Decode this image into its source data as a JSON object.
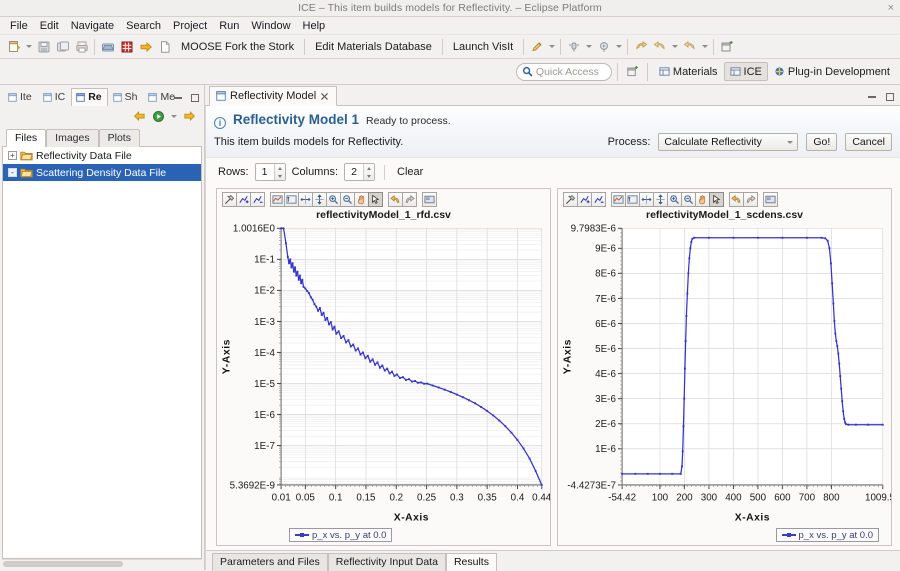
{
  "window": {
    "title": "ICE – This item builds models for Reflectivity. – Eclipse Platform",
    "close_label": "×"
  },
  "menu": {
    "items": [
      "File",
      "Edit",
      "Navigate",
      "Search",
      "Project",
      "Run",
      "Window",
      "Help"
    ]
  },
  "toolbar": {
    "text_buttons": [
      "MOOSE Fork the Stork",
      "Edit Materials Database",
      "Launch VisIt"
    ],
    "icons": [
      "new-wizard-icon",
      "save-icon",
      "save-all-icon",
      "print-icon",
      "open-item-icon",
      "grid-icon",
      "forward-arrow-icon",
      "new-file-icon",
      "run-visit-icon",
      "debug-icon",
      "run-icon",
      "back-nav-icon",
      "forward-nav-icon",
      "next-annotation-icon",
      "open-perspective-icon"
    ]
  },
  "quick_access": {
    "placeholder": "Quick Access",
    "search_icon": "search-icon"
  },
  "perspectives": {
    "open_icon": "open-perspective-icon",
    "items": [
      {
        "label": "Materials",
        "active": false
      },
      {
        "label": "ICE",
        "active": true
      },
      {
        "label": "Plug-in Development",
        "active": false
      }
    ]
  },
  "sidebar": {
    "tabs": [
      {
        "label": "Ite",
        "active": false
      },
      {
        "label": "IC",
        "active": false
      },
      {
        "label": "Re",
        "active": true
      },
      {
        "label": "Sh",
        "active": false
      },
      {
        "label": "Me",
        "active": false
      }
    ],
    "nav": [
      "back-arrow-icon",
      "play-icon",
      "chevron-down-icon",
      "forward-arrow-icon"
    ],
    "minimize_icon": "minimize-icon",
    "maximize_icon": "maximize-icon",
    "subtabs": [
      {
        "label": "Files",
        "active": true
      },
      {
        "label": "Images",
        "active": false
      },
      {
        "label": "Plots",
        "active": false
      }
    ],
    "tree": [
      {
        "label": "Reflectivity Data File",
        "expander": "+",
        "selected": false
      },
      {
        "label": "Scattering Density Data File",
        "expander": "-",
        "selected": true
      }
    ]
  },
  "editor": {
    "tab": {
      "label": "Reflectivity Model",
      "close_icon": "close-icon",
      "editor_icon": "editor-icon"
    },
    "minimize_icon": "minimize-icon",
    "maximize_icon": "maximize-icon",
    "form": {
      "info_icon": "info-icon",
      "title": "Reflectivity Model 1",
      "status": "Ready to process.",
      "description": "This item builds models for Reflectivity.",
      "process_label": "Process:",
      "process_value": "Calculate Reflectivity",
      "process_options": [
        "Calculate Reflectivity"
      ],
      "go_label": "Go!",
      "cancel_label": "Cancel"
    },
    "grid_controls": {
      "rows_label": "Rows:",
      "rows_value": "1",
      "columns_label": "Columns:",
      "columns_value": "2",
      "clear_label": "Clear"
    },
    "bottom_tabs": [
      {
        "label": "Parameters and Files",
        "active": false
      },
      {
        "label": "Reflectivity Input Data",
        "active": false
      },
      {
        "label": "Results",
        "active": true
      }
    ]
  },
  "plot_toolbar": {
    "buttons": [
      "clear-plot-icon",
      "add-series-icon",
      "remove-series-icon",
      "auto-scale-icon",
      "auto-scale-y-icon",
      "auto-scale-x-icon",
      "snap-to-grid-icon",
      "zoom-in-icon",
      "zoom-out-icon",
      "pan-icon",
      "select-icon",
      "undo-icon",
      "redo-icon",
      "save-image-icon"
    ],
    "active_button": "select-icon"
  },
  "chart_data": [
    {
      "type": "line",
      "title": "reflectivityModel_1_rfd.csv",
      "xlabel": "X-Axis",
      "ylabel": "Y-Axis",
      "yscale": "log",
      "xlim": [
        0.01,
        0.44
      ],
      "ylim": [
        5.3692e-09,
        1.0016
      ],
      "ytick_labels": [
        "1.0016E0",
        "1E-1",
        "1E-2",
        "1E-3",
        "1E-4",
        "1E-5",
        "1E-6",
        "1E-7",
        "5.3692E-9"
      ],
      "ytick_values": [
        1.0016,
        0.1,
        0.01,
        0.001,
        0.0001,
        1e-05,
        1e-06,
        1e-07,
        5.3692e-09
      ],
      "xtick_labels": [
        "0.01",
        "0.05",
        "0.1",
        "0.15",
        "0.2",
        "0.25",
        "0.3",
        "0.35",
        "0.4",
        "0.44"
      ],
      "xtick_values": [
        0.01,
        0.05,
        0.1,
        0.15,
        0.2,
        0.25,
        0.3,
        0.35,
        0.4,
        0.44
      ],
      "legend": "p_x vs. p_y at 0.0",
      "legend_position": "bottom-left",
      "grid": true,
      "series": [
        {
          "name": "p_x vs. p_y at 0.0",
          "color": "#3333cc",
          "x": [
            0.01,
            0.014,
            0.018,
            0.021,
            0.023,
            0.025,
            0.027,
            0.029,
            0.031,
            0.033,
            0.035,
            0.037,
            0.039,
            0.041,
            0.043,
            0.045,
            0.047,
            0.05,
            0.053,
            0.056,
            0.059,
            0.062,
            0.065,
            0.068,
            0.071,
            0.074,
            0.077,
            0.08,
            0.083,
            0.086,
            0.089,
            0.092,
            0.095,
            0.098,
            0.101,
            0.105,
            0.109,
            0.113,
            0.117,
            0.121,
            0.125,
            0.129,
            0.133,
            0.137,
            0.141,
            0.145,
            0.149,
            0.153,
            0.157,
            0.161,
            0.165,
            0.169,
            0.173,
            0.177,
            0.181,
            0.185,
            0.189,
            0.193,
            0.197,
            0.201,
            0.206,
            0.211,
            0.216,
            0.221,
            0.226,
            0.231,
            0.236,
            0.241,
            0.246,
            0.251,
            0.26,
            0.27,
            0.28,
            0.29,
            0.3,
            0.31,
            0.32,
            0.33,
            0.34,
            0.35,
            0.36,
            0.37,
            0.38,
            0.39,
            0.4,
            0.41,
            0.42,
            0.43,
            0.44
          ],
          "y": [
            1.0016,
            1.0,
            0.33,
            0.12,
            0.075,
            0.1,
            0.055,
            0.075,
            0.04,
            0.055,
            0.03,
            0.04,
            0.022,
            0.03,
            0.017,
            0.022,
            0.013,
            0.0115,
            0.0095,
            0.0082,
            0.006,
            0.005,
            0.0036,
            0.003,
            0.0022,
            0.0027,
            0.0016,
            0.0019,
            0.0011,
            0.0013,
            0.0008,
            0.00095,
            0.00055,
            0.00068,
            0.0004,
            0.00048,
            0.00029,
            0.00034,
            0.00021,
            0.00025,
            0.000155,
            0.00018,
            0.000115,
            0.000135,
            8.5e-05,
            0.0001,
            6.5e-05,
            7.8e-05,
            5e-05,
            6e-05,
            4e-05,
            4.8e-05,
            3.2e-05,
            3.8e-05,
            2.6e-05,
            3e-05,
            2.1e-05,
            2.4e-05,
            1.75e-05,
            1.95e-05,
            1.5e-05,
            1.6e-05,
            1.3e-05,
            1.38e-05,
            1.15e-05,
            1.2e-05,
            1.05e-05,
            1.08e-05,
            9.8e-06,
            9.9e-06,
            8.6e-06,
            7.4e-06,
            6.3e-06,
            5.3e-06,
            4.4e-06,
            3.6e-06,
            2.9e-06,
            2.3e-06,
            1.75e-06,
            1.3e-06,
            9.3e-07,
            6.4e-07,
            4.2e-07,
            2.6e-07,
            1.5e-07,
            8e-08,
            3.8e-08,
            1.5e-08,
            5.3692e-09
          ]
        }
      ]
    },
    {
      "type": "line",
      "title": "reflectivityModel_1_scdens.csv",
      "xlabel": "X-Axis",
      "ylabel": "Y-Axis",
      "yscale": "linear",
      "xlim": [
        -54.42,
        1009.53
      ],
      "ylim": [
        -4.4273e-07,
        9.7983e-06
      ],
      "ytick_labels": [
        "9.7983E-6",
        "9E-6",
        "8E-6",
        "7E-6",
        "6E-6",
        "5E-6",
        "4E-6",
        "3E-6",
        "2E-6",
        "1E-6",
        "-4.4273E-7"
      ],
      "ytick_values": [
        9.7983e-06,
        9e-06,
        8e-06,
        7e-06,
        6e-06,
        5e-06,
        4e-06,
        3e-06,
        2e-06,
        1e-06,
        -4.4273e-07
      ],
      "xtick_labels": [
        "-54.42",
        "100",
        "200",
        "300",
        "400",
        "500",
        "600",
        "700",
        "800",
        "1009.53"
      ],
      "xtick_values": [
        -54.42,
        100,
        200,
        300,
        400,
        500,
        600,
        700,
        800,
        1009.53
      ],
      "legend": "p_x vs. p_y at 0.0",
      "legend_position": "bottom-right",
      "grid": true,
      "series": [
        {
          "name": "p_x vs. p_y at 0.0",
          "color": "#3333cc",
          "x": [
            -54.42,
            0,
            50,
            100,
            150,
            185,
            190,
            193,
            196,
            199,
            202,
            205,
            208,
            212,
            216,
            220,
            224,
            228,
            232,
            240,
            300,
            400,
            500,
            600,
            700,
            760,
            775,
            785,
            792,
            798,
            803,
            808,
            812,
            816,
            820,
            824,
            828,
            832,
            836,
            840,
            844,
            848,
            852,
            856,
            860,
            870,
            900,
            950,
            1009.53
          ],
          "y": [
            0,
            0,
            0,
            0,
            0,
            0,
            3e-07,
            9e-07,
            1.9e-06,
            3e-06,
            4.2e-06,
            5.3e-06,
            6.3e-06,
            7.2e-06,
            8e-06,
            8.6e-06,
            9e-06,
            9.25e-06,
            9.38e-06,
            9.42e-06,
            9.42e-06,
            9.42e-06,
            9.42e-06,
            9.42e-06,
            9.42e-06,
            9.42e-06,
            9.4e-06,
            9.3e-06,
            9e-06,
            8.4e-06,
            7.6e-06,
            6.8e-06,
            6.1e-06,
            5.6e-06,
            5.3e-06,
            5.1e-06,
            4.8e-06,
            4.4e-06,
            3.9e-06,
            3.4e-06,
            2.9e-06,
            2.5e-06,
            2.2e-06,
            2.05e-06,
            1.98e-06,
            1.96e-06,
            1.96e-06,
            1.96e-06,
            1.96e-06
          ]
        }
      ]
    }
  ]
}
